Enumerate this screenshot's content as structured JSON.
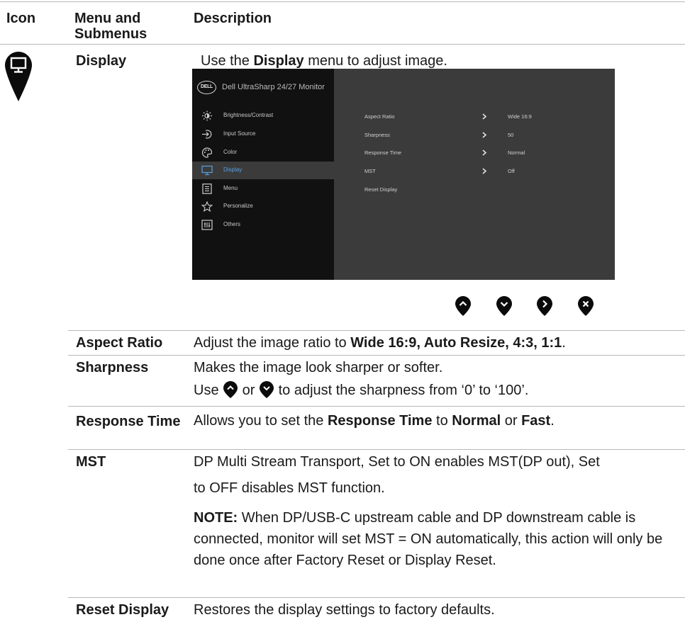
{
  "header": {
    "icon": "Icon",
    "menu": "Menu and Submenus",
    "description": "Description"
  },
  "display_section": {
    "title": "Display",
    "intro_pre": "Use the ",
    "intro_bold": "Display",
    "intro_post": " menu to adjust image."
  },
  "osd": {
    "logo": "DELL",
    "title": "Dell UltraSharp 24/27 Monitor",
    "menu_items": [
      {
        "label": "Brightness/Contrast",
        "icon": "sun-icon"
      },
      {
        "label": "Input Source",
        "icon": "input-icon"
      },
      {
        "label": "Color",
        "icon": "palette-icon"
      },
      {
        "label": "Display",
        "icon": "monitor-icon"
      },
      {
        "label": "Menu",
        "icon": "menu-list-icon"
      },
      {
        "label": "Personalize",
        "icon": "star-icon"
      },
      {
        "label": "Others",
        "icon": "others-icon"
      }
    ],
    "active_item": "Display",
    "submenu": [
      {
        "label": "Aspect Ratio",
        "value": "Wide 16:9"
      },
      {
        "label": "Sharpness",
        "value": "50"
      },
      {
        "label": "Response Time",
        "value": "Normal"
      },
      {
        "label": "MST",
        "value": "Off"
      },
      {
        "label": "Reset Display",
        "value": ""
      }
    ],
    "accent_color": "#5aa0e0"
  },
  "nav_buttons": [
    "up-arrow-icon",
    "down-arrow-icon",
    "right-arrow-icon",
    "close-icon"
  ],
  "rows": {
    "aspect_ratio": {
      "name": "Aspect Ratio",
      "pre": "Adjust the image ratio to ",
      "bold": "Wide 16:9, Auto Resize, 4:3, 1:1",
      "post": "."
    },
    "sharpness": {
      "name": "Sharpness",
      "line1": "Makes the image look sharper or softer.",
      "line2_a": "Use ",
      "line2_b": " or ",
      "line2_c": " to adjust the sharpness from ‘0’ to ‘100’."
    },
    "response_time": {
      "name": "Response Time",
      "pre": "Allows you to set the ",
      "bold1": "Response Time",
      "mid1": " to ",
      "bold2": "Normal",
      "mid2": " or ",
      "bold3": "Fast",
      "post": "."
    },
    "mst": {
      "name": "MST",
      "line1": "DP Multi Stream Transport,  Set to ON enables MST(DP out), Set",
      "line2": "to OFF disables MST function.",
      "note_label": "NOTE:",
      "note_text": " When DP/USB-C upstream cable and DP downstream cable is connected, monitor will set MST = ON automatically, this action will only be done once after Factory Reset or Display Reset."
    },
    "reset_display": {
      "name": "Reset Display",
      "text": "Restores the display settings to factory defaults."
    }
  }
}
